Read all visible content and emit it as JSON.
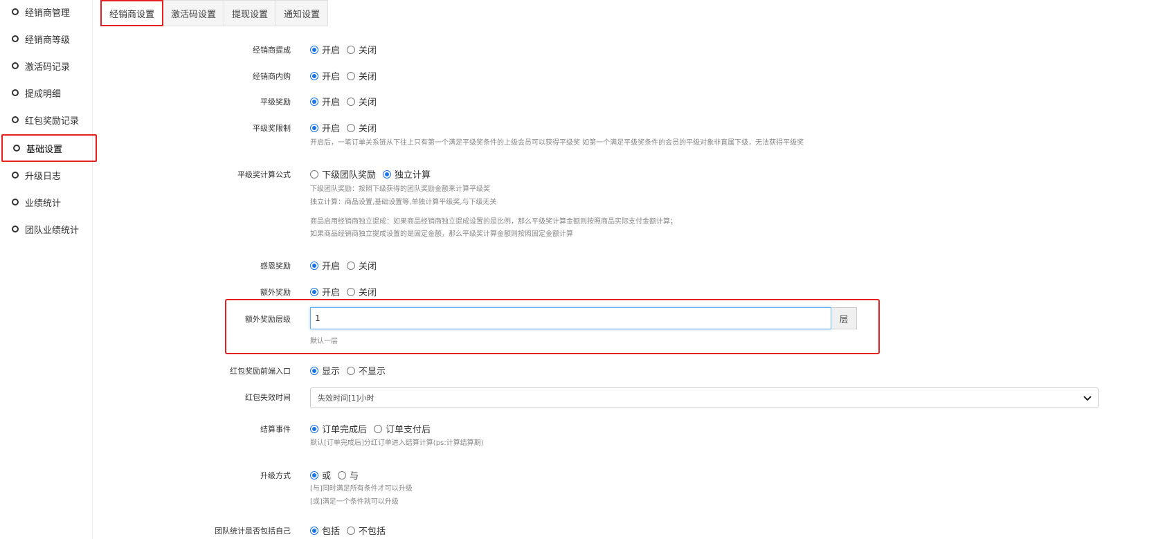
{
  "sidebar": {
    "items": [
      {
        "label": "经销商管理"
      },
      {
        "label": "经销商等级"
      },
      {
        "label": "激活码记录"
      },
      {
        "label": "提成明细"
      },
      {
        "label": "红包奖励记录"
      },
      {
        "label": "基础设置"
      },
      {
        "label": "升级日志"
      },
      {
        "label": "业绩统计"
      },
      {
        "label": "团队业绩统计"
      }
    ]
  },
  "tabs": [
    {
      "label": "经销商设置"
    },
    {
      "label": "激活码设置"
    },
    {
      "label": "提现设置"
    },
    {
      "label": "通知设置"
    }
  ],
  "form": {
    "commission": {
      "label": "经销商提成",
      "on": "开启",
      "off": "关闭"
    },
    "inner_buy": {
      "label": "经销商内购",
      "on": "开启",
      "off": "关闭"
    },
    "peer_reward": {
      "label": "平级奖励",
      "on": "开启",
      "off": "关闭"
    },
    "peer_limit": {
      "label": "平级奖限制",
      "on": "开启",
      "off": "关闭",
      "help": "开启后，一笔订单关系链从下往上只有第一个满足平级奖条件的上级会员可以获得平级奖 如第一个满足平级奖条件的会员的平级对象非直属下级，无法获得平级奖"
    },
    "peer_formula": {
      "label": "平级奖计算公式",
      "opt1": "下级团队奖励",
      "opt2": "独立计算",
      "help1": "下级团队奖励：按照下级获得的团队奖励金额来计算平级奖",
      "help2": "独立计算：商品设置,基础设置等,单独计算平级奖,与下级无关",
      "help3": "商品启用经销商独立提成：如果商品经销商独立提成设置的是比例，那么平级奖计算金额则按照商品实际支付金额计算；",
      "help4": "如果商品经销商独立提成设置的是固定金额，那么平级奖计算金额则按照固定金额计算"
    },
    "gratitude": {
      "label": "感恩奖励",
      "on": "开启",
      "off": "关闭"
    },
    "extra_reward": {
      "label": "额外奖励",
      "on": "开启",
      "off": "关闭"
    },
    "extra_levels": {
      "label": "额外奖励层级",
      "value": "1",
      "addon": "层",
      "help": "默认一层"
    },
    "red_packet_entry": {
      "label": "红包奖励前端入口",
      "on": "显示",
      "off": "不显示"
    },
    "red_packet_expire": {
      "label": "红包失效时间",
      "selected": "失效时间[1]小时"
    },
    "settle_event": {
      "label": "结算事件",
      "opt1": "订单完成后",
      "opt2": "订单支付后",
      "help": "默认[订单完成后]分红订单进入结算计算(ps:计算结算期)"
    },
    "upgrade_mode": {
      "label": "升级方式",
      "opt1": "或",
      "opt2": "与",
      "help1": "[与]同时满足所有条件才可以升级",
      "help2": "[或]满足一个条件就可以升级"
    },
    "team_self": {
      "label": "团队统计是否包括自己",
      "on": "包括",
      "off": "不包括"
    }
  },
  "colors": {
    "accent": "#1a73e8",
    "highlight": "#e52020"
  }
}
